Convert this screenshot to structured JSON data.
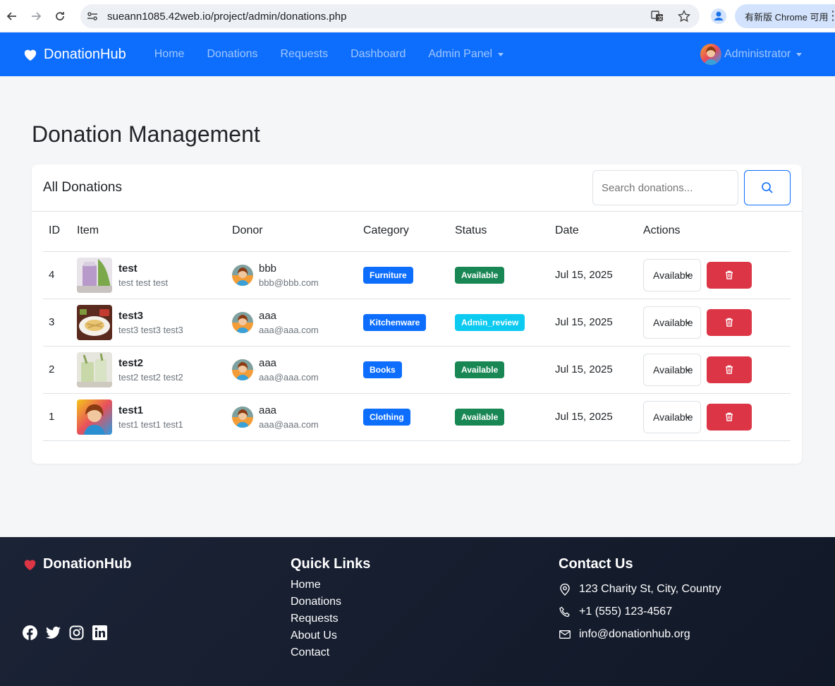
{
  "browser": {
    "url": "sueann1085.42web.io/project/admin/donations.php",
    "update_label": "有新版 Chrome 可用"
  },
  "navbar": {
    "brand": "DonationHub",
    "links": [
      "Home",
      "Donations",
      "Requests",
      "Dashboard"
    ],
    "admin_panel": "Admin Panel",
    "user": "Administrator",
    "color": "#0d6efd"
  },
  "main": {
    "title": "Donation Management",
    "card_title": "All Donations",
    "search_placeholder": "Search donations...",
    "columns": [
      "ID",
      "Item",
      "Donor",
      "Category",
      "Status",
      "Date",
      "Actions"
    ],
    "rows": [
      {
        "id": "4",
        "name": "test",
        "desc": "test test test",
        "donor": "bbb",
        "email": "bbb@bbb.com",
        "category": "Furniture",
        "status": "Available",
        "date": "Jul 15, 2025",
        "select": "Available"
      },
      {
        "id": "3",
        "name": "test3",
        "desc": "test3 test3 test3",
        "donor": "aaa",
        "email": "aaa@aaa.com",
        "category": "Kitchenware",
        "status": "Admin_review",
        "date": "Jul 15, 2025",
        "select": "Available"
      },
      {
        "id": "2",
        "name": "test2",
        "desc": "test2 test2 test2",
        "donor": "aaa",
        "email": "aaa@aaa.com",
        "category": "Books",
        "status": "Available",
        "date": "Jul 15, 2025",
        "select": "Available"
      },
      {
        "id": "1",
        "name": "test1",
        "desc": "test1 test1 test1",
        "donor": "aaa",
        "email": "aaa@aaa.com",
        "category": "Clothing",
        "status": "Available",
        "date": "Jul 15, 2025",
        "select": "Available"
      }
    ],
    "colors": {
      "category": "#0d6efd",
      "available": "#198754",
      "admin_review": "#0dcaf0",
      "delete": "#dc3545"
    }
  },
  "footer": {
    "brand": "DonationHub",
    "quick_links_title": "Quick Links",
    "quick_links": [
      "Home",
      "Donations",
      "Requests",
      "About Us",
      "Contact"
    ],
    "contact_title": "Contact Us",
    "address": "123 Charity St, City, Country",
    "phone": "+1 (555) 123-4567",
    "email": "info@donationhub.org",
    "socials": [
      "facebook-icon",
      "twitter-icon",
      "instagram-icon",
      "linkedin-icon"
    ]
  }
}
